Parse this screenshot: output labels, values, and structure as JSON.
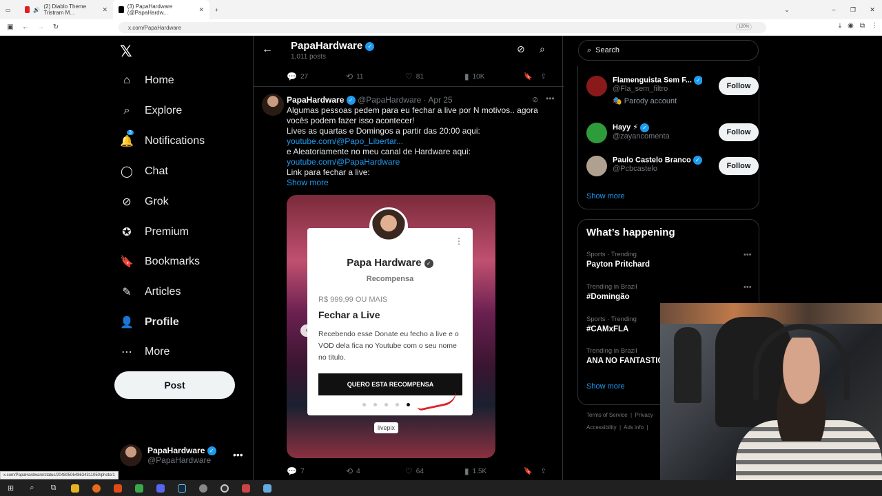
{
  "browser": {
    "tabs": [
      {
        "title": "(2) Diablo Theme Tristram M...",
        "icon_color": "#e02020"
      },
      {
        "title": "(3) PapaHardware (@PapaHardw...",
        "icon_color": "#000000"
      }
    ],
    "url": "x.com/PapaHardware",
    "zoom": "120%",
    "status_url": "x.com/PapaHardware/status/2048050648634311050/photo/1"
  },
  "sidebar": {
    "logo": "𝕏",
    "items": [
      {
        "label": "Home",
        "icon": "home-icon"
      },
      {
        "label": "Explore",
        "icon": "search-icon"
      },
      {
        "label": "Notifications",
        "icon": "bell-icon",
        "badge": "3"
      },
      {
        "label": "Chat",
        "icon": "chat-icon"
      },
      {
        "label": "Grok",
        "icon": "grok-icon"
      },
      {
        "label": "Premium",
        "icon": "premium-icon"
      },
      {
        "label": "Bookmarks",
        "icon": "bookmark-icon"
      },
      {
        "label": "Articles",
        "icon": "articles-icon"
      },
      {
        "label": "Profile",
        "icon": "profile-icon"
      },
      {
        "label": "More",
        "icon": "more-icon"
      }
    ],
    "post_label": "Post",
    "account": {
      "name": "PapaHardware",
      "handle": "@PapaHardware"
    }
  },
  "profile_header": {
    "name": "PapaHardware",
    "posts": "1,011 posts"
  },
  "prev_actions": {
    "replies": "27",
    "reposts": "11",
    "likes": "81",
    "views": "10K"
  },
  "tweet": {
    "name": "PapaHardware",
    "handle": "@PapaHardware",
    "date": "Apr 25",
    "lines": [
      "Algumas pessoas pedem para eu fechar a live por N motivos.. agora vocês podem fazer isso acontecer!",
      "Lives as quartas e Domingos a partir das 20:00 aqui:",
      "youtube.com/@Papo_Libertar...",
      "e Aleatoriamente no meu canal de Hardware aqui:",
      "youtube.com/@PapaHardware",
      "Link para fechar a live:"
    ],
    "show_more": "Show more",
    "actions": {
      "replies": "7",
      "reposts": "4",
      "likes": "64",
      "views": "1.5K"
    }
  },
  "media_card": {
    "name": "Papa Hardware",
    "subtitle": "Recompensa",
    "price": "R$ 999,99 OU MAIS",
    "title": "Fechar a Live",
    "description": "Recebendo esse Donate eu fecho a live e o VOD dela fica no Youtube com o seu nome no titulo.",
    "button": "QUERO ESTA RECOMPENSA",
    "active_slide": 5,
    "slides": 5,
    "brand": "livepix"
  },
  "right": {
    "search_placeholder": "Search",
    "who_to_follow": [
      {
        "name": "Flamenguista Sem F...",
        "handle": "@Fla_sem_filtro",
        "note": "Parody account",
        "avatar_color": "#8a1a1a"
      },
      {
        "name": "Hayy ⚡",
        "handle": "@zayancomenta",
        "avatar_color": "#2e9c3a"
      },
      {
        "name": "Paulo Castelo Branco",
        "handle": "@Pcbcastelo",
        "avatar_color": "#b0a090"
      }
    ],
    "follow_label": "Follow",
    "show_more": "Show more",
    "trends_title": "What’s happening",
    "trends": [
      {
        "context": "Sports · Trending",
        "name": "Payton Pritchard"
      },
      {
        "context": "Trending in Brazil",
        "name": "#Domingão"
      },
      {
        "context": "Sports · Trending",
        "name": "#CAMxFLA"
      },
      {
        "context": "Trending in Brazil",
        "name": "ANA NO FANTASTIC"
      }
    ],
    "trends_show_more": "Show more",
    "footer": [
      "Terms of Service",
      "Privacy",
      "Accessibility",
      "Ads info"
    ]
  },
  "colors": {
    "accent": "#1d9bf0",
    "background": "#000000",
    "text": "#e7e9ea",
    "muted": "#71767b"
  }
}
